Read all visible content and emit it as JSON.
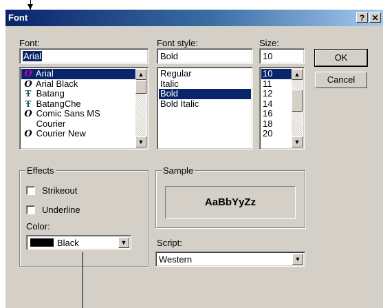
{
  "window": {
    "title": "Font",
    "help_glyph": "?",
    "close_glyph": "✕"
  },
  "font": {
    "label": "Font:",
    "value": "Arial",
    "items": [
      {
        "name": "Arial",
        "icon": "opentype-icon",
        "selected": true
      },
      {
        "name": "Arial Black",
        "icon": "opentype-icon"
      },
      {
        "name": "Batang",
        "icon": "truetype-icon"
      },
      {
        "name": "BatangChe",
        "icon": "truetype-icon"
      },
      {
        "name": "Comic Sans MS",
        "icon": "opentype-icon"
      },
      {
        "name": "Courier",
        "icon": "none"
      },
      {
        "name": "Courier New",
        "icon": "opentype-icon"
      }
    ]
  },
  "style": {
    "label": "Font style:",
    "value": "Bold",
    "items": [
      "Regular",
      "Italic",
      "Bold",
      "Bold Italic"
    ],
    "selected": "Bold"
  },
  "size": {
    "label": "Size:",
    "value": "10",
    "items": [
      "10",
      "11",
      "12",
      "14",
      "16",
      "18",
      "20"
    ],
    "selected": "10"
  },
  "buttons": {
    "ok": "OK",
    "cancel": "Cancel"
  },
  "effects": {
    "title": "Effects",
    "strikeout": "Strikeout",
    "underline": "Underline",
    "color_label": "Color:",
    "color_value": "Black",
    "color_swatch": "#000000"
  },
  "sample": {
    "title": "Sample",
    "text": "AaBbYyZz"
  },
  "script": {
    "label": "Script:",
    "value": "Western"
  },
  "colors": {
    "titlebar_start": "#0a246a",
    "titlebar_end": "#a6caf0",
    "selection": "#0a246a",
    "face": "#d4d0c8"
  }
}
